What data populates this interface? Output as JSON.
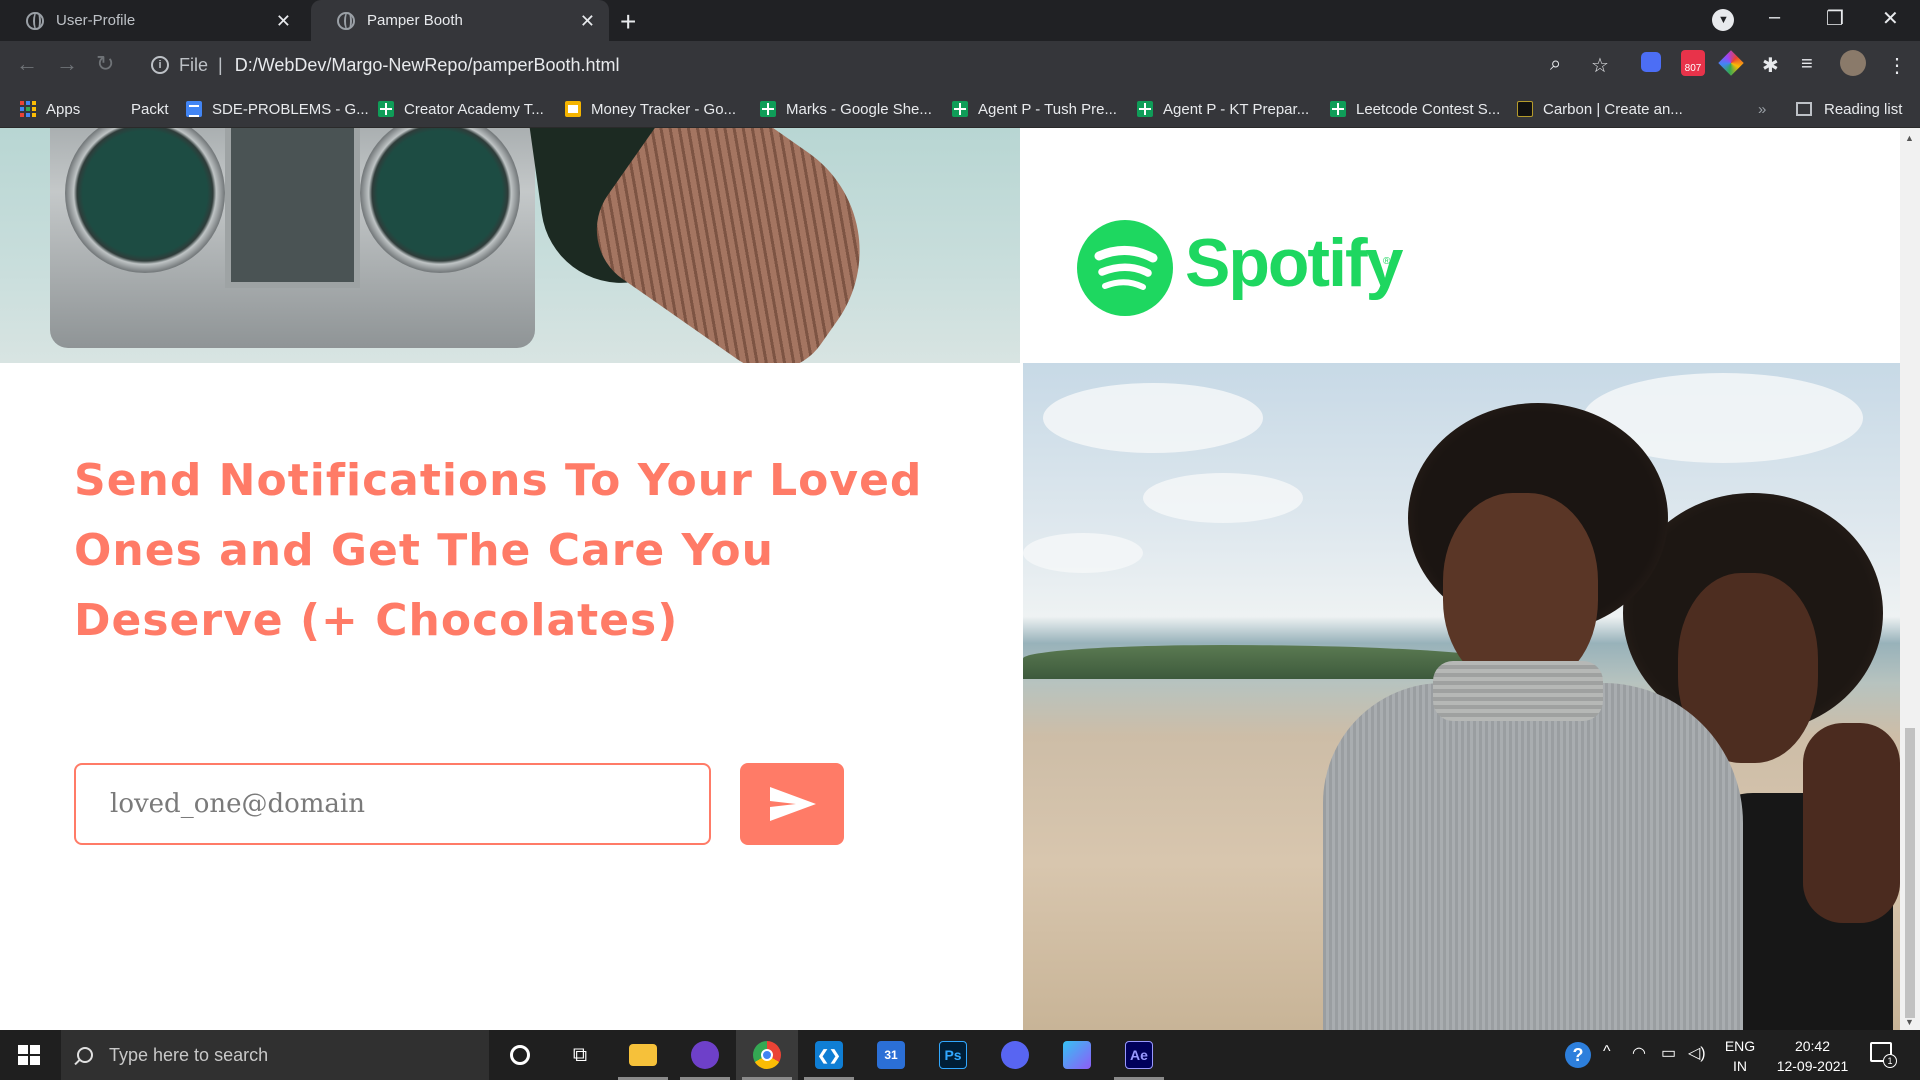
{
  "browser": {
    "tabs": [
      {
        "title": "User-Profile",
        "active": false
      },
      {
        "title": "Pamper Booth",
        "active": true
      }
    ],
    "address": {
      "scheme_label": "File",
      "url": "D:/WebDev/Margo-NewRepo/pamperBooth.html"
    },
    "extension_badge": "807",
    "bookmarks": [
      {
        "label": "Apps",
        "icon": "apps-grid-icon"
      },
      {
        "label": "Packt",
        "icon": "none"
      },
      {
        "label": "SDE-PROBLEMS - G...",
        "icon": "google-docs-icon"
      },
      {
        "label": "Creator Academy T...",
        "icon": "google-sheets-icon"
      },
      {
        "label": "Money Tracker - Go...",
        "icon": "google-slides-icon"
      },
      {
        "label": "Marks - Google She...",
        "icon": "google-sheets-icon"
      },
      {
        "label": "Agent P - Tush Pre...",
        "icon": "google-sheets-icon"
      },
      {
        "label": "Agent P - KT Prepar...",
        "icon": "google-sheets-icon"
      },
      {
        "label": "Leetcode Contest S...",
        "icon": "google-sheets-icon"
      },
      {
        "label": "Carbon | Create an...",
        "icon": "carbon-icon"
      }
    ],
    "bookmarks_overflow": "»",
    "reading_list": "Reading list"
  },
  "page": {
    "spotify_wordmark": "Spotify",
    "spotify_reg_mark": "®",
    "headline": "Send Notifications To Your Loved Ones and Get The Care You Deserve (+ Chocolates)",
    "email_placeholder": "loved_one@domain",
    "colors": {
      "accent": "#ff7b67",
      "spotify_green": "#1ed760"
    }
  },
  "taskbar": {
    "search_placeholder": "Type here to search",
    "apps": [
      "cortana-icon",
      "task-view-icon",
      "file-explorer-icon",
      "github-desktop-icon",
      "chrome-icon",
      "vscode-icon",
      "calendar-icon",
      "photoshop-icon",
      "discord-icon",
      "app-icon",
      "after-effects-icon"
    ],
    "calendar_day": "31",
    "photoshop_label": "Ps",
    "after_effects_label": "Ae",
    "language": "ENG",
    "region": "IN",
    "time": "20:42",
    "date": "12-09-2021",
    "notification_count": "1"
  }
}
